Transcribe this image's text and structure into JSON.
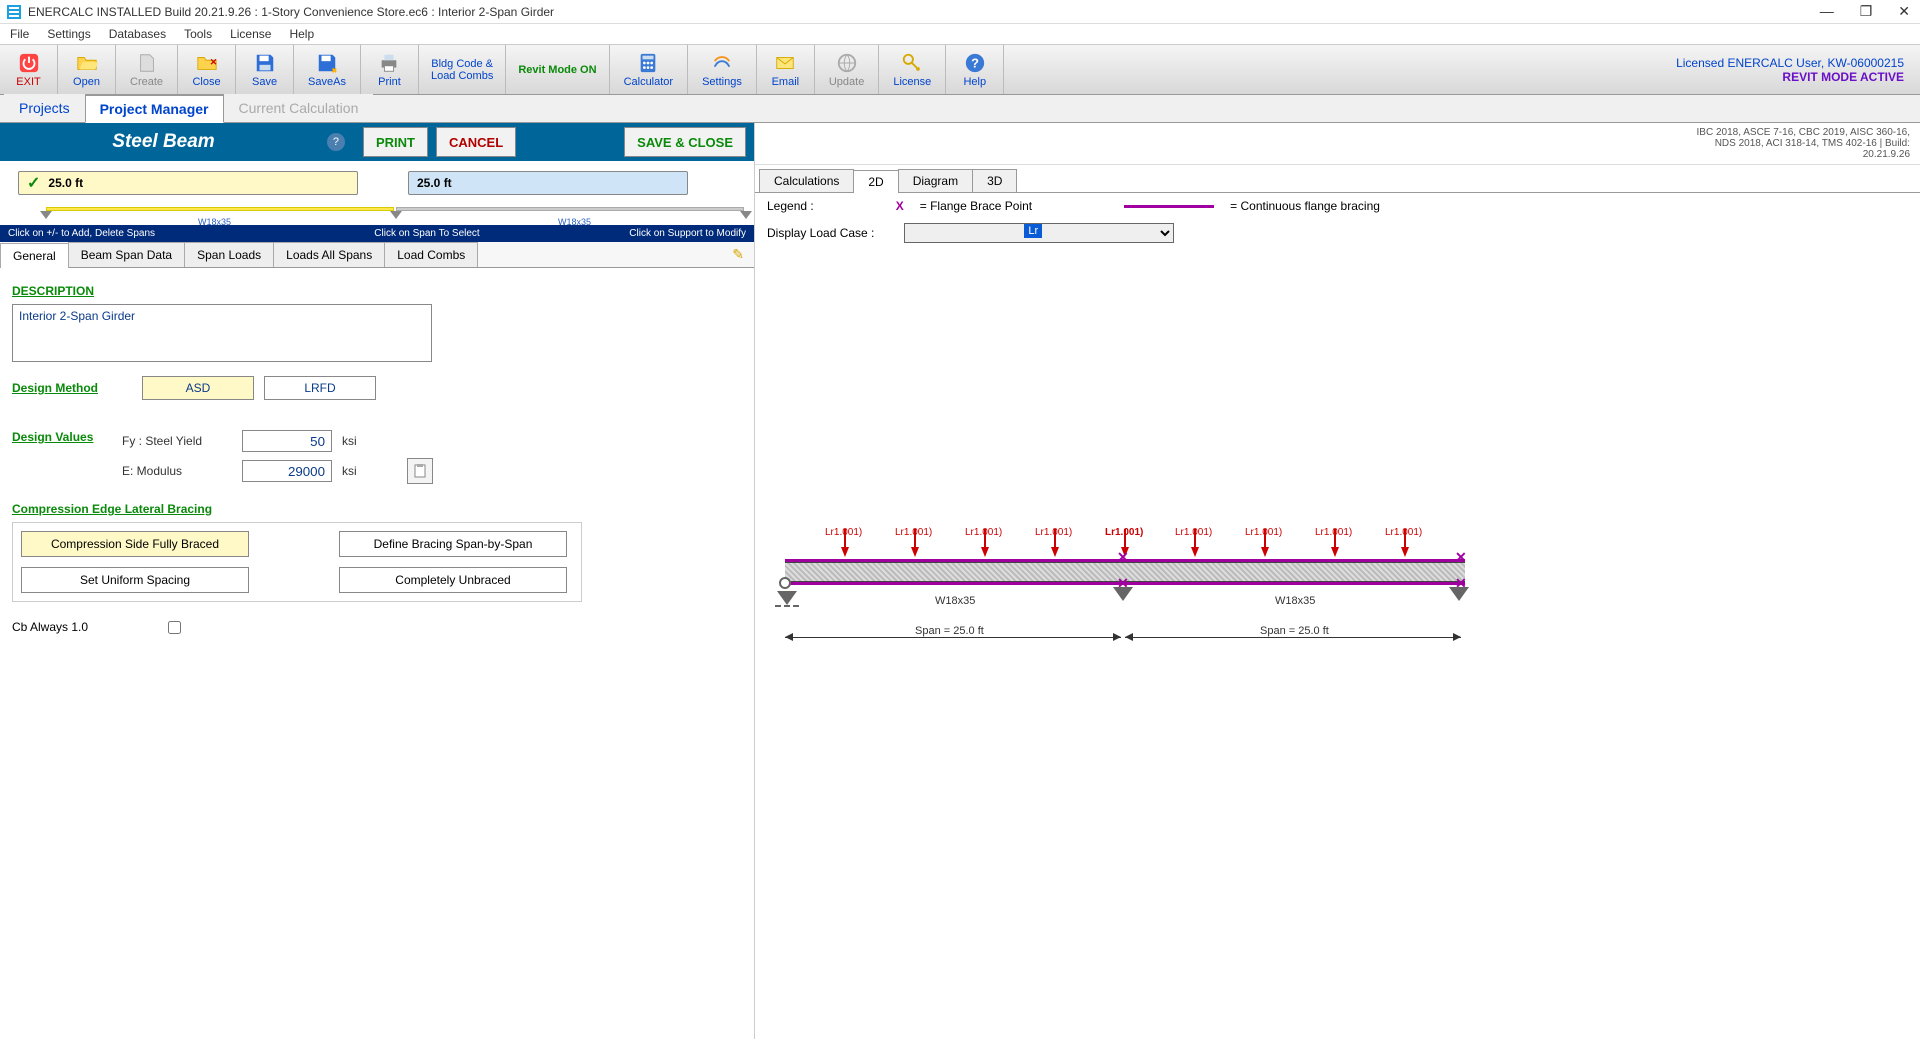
{
  "window": {
    "title": "ENERCALC INSTALLED Build 20.21.9.26 :  1-Story Convenience Store.ec6 : Interior 2-Span Girder"
  },
  "menu": [
    "File",
    "Settings",
    "Databases",
    "Tools",
    "License",
    "Help"
  ],
  "ribbon": {
    "exit": "EXIT",
    "open": "Open",
    "create": "Create",
    "close": "Close",
    "save": "Save",
    "saveas": "SaveAs",
    "print": "Print",
    "bldg": "Bldg Code &\nLoad Combs",
    "revit": "Revit Mode ON",
    "calc": "Calculator",
    "settings": "Settings",
    "email": "Email",
    "update": "Update",
    "license": "License",
    "help": "Help",
    "licensed": "Licensed ENERCALC User, KW-06000215",
    "revit_active": "REVIT MODE ACTIVE"
  },
  "nav": {
    "projects": "Projects",
    "pm": "Project Manager",
    "cc": "Current Calculation"
  },
  "header": {
    "title": "Steel Beam",
    "print": "PRINT",
    "cancel": "CANCEL",
    "saveclose": "SAVE & CLOSE"
  },
  "spans": {
    "span1": "25.0 ft",
    "span2": "25.0 ft",
    "beam_label": "W18x35"
  },
  "instr": {
    "add": "Click on  +/-  to Add, Delete Spans",
    "sel": "Click on Span To Select",
    "sup": "Click on Support to Modify"
  },
  "prop_tabs": [
    "General",
    "Beam Span Data",
    "Span Loads",
    "Loads All Spans",
    "Load Combs"
  ],
  "general": {
    "desc_label": "DESCRIPTION",
    "desc_value": "Interior 2-Span Girder",
    "dm_label": "Design Method",
    "asd": "ASD",
    "lrfd": "LRFD",
    "dv_label": "Design Values",
    "fy_label": "Fy : Steel Yield",
    "fy_val": "50",
    "fy_unit": "ksi",
    "e_label": "E: Modulus",
    "e_val": "29000",
    "e_unit": "ksi",
    "brace_label": "Compression Edge Lateral Bracing",
    "brace_full": "Compression Side Fully Braced",
    "brace_span": "Define Bracing Span-by-Span",
    "brace_uni": "Set Uniform Spacing",
    "brace_none": "Completely Unbraced",
    "cb_label": "Cb Always 1.0"
  },
  "right": {
    "codes": "IBC 2018, ASCE 7-16, CBC 2019, AISC 360-16,\nNDS 2018, ACI 318-14, TMS 402-16 | Build:\n20.21.9.26",
    "view_tabs": [
      "Calculations",
      "2D",
      "Diagram",
      "3D"
    ],
    "legend_label": "Legend :",
    "legend_x": "X",
    "legend_xtxt": "= Flange Brace Point",
    "legend_ctxt": "= Continuous flange bracing",
    "load_label": "Display Load Case :",
    "load_sel": "Lr",
    "da": {
      "load_lbl": "Lr1.001)",
      "beam": "W18x35",
      "span": "Span = 25.0 ft"
    }
  }
}
